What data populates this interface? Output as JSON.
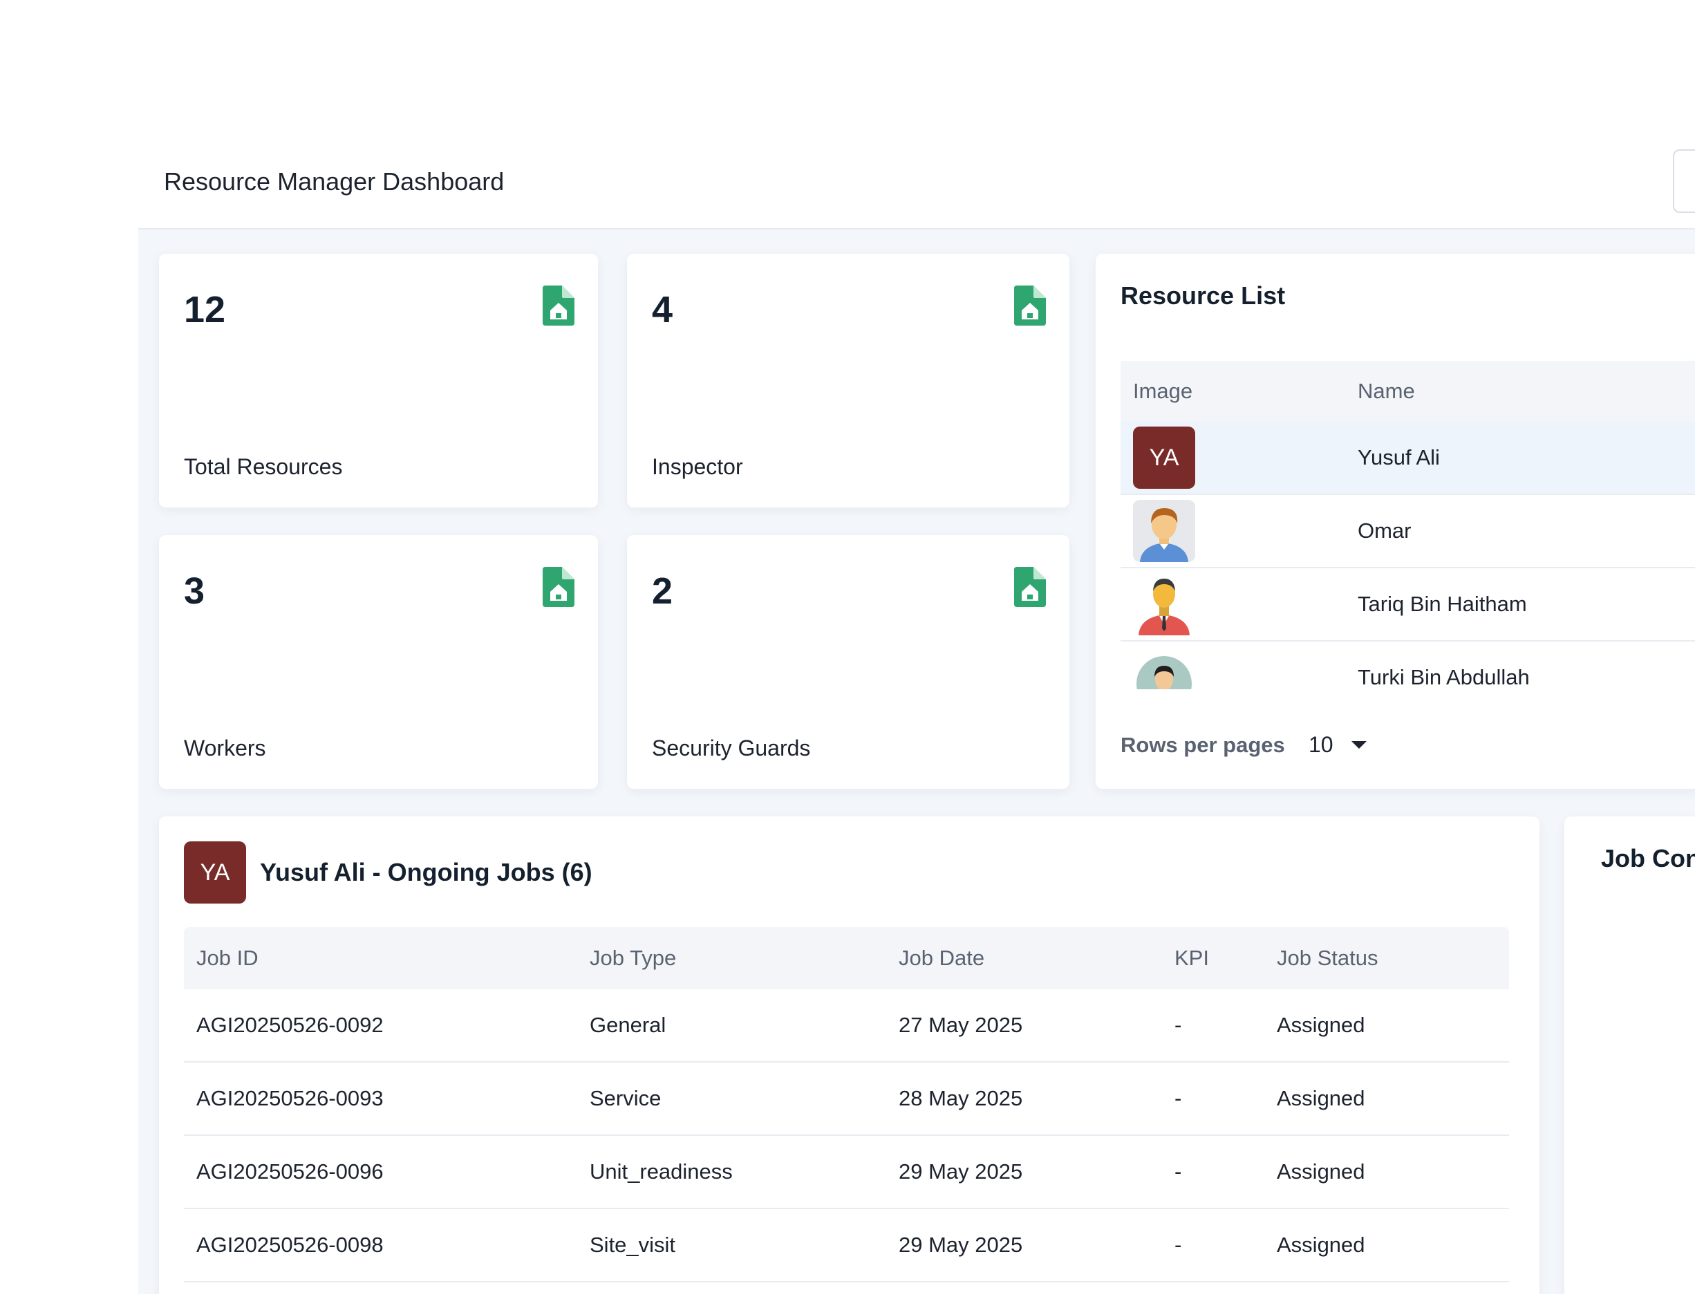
{
  "header": {
    "title": "Resource Manager Dashboard"
  },
  "stats": [
    {
      "value": "12",
      "label": "Total Resources",
      "icon": "document-icon"
    },
    {
      "value": "4",
      "label": "Inspector",
      "icon": "document-icon"
    },
    {
      "value": "3",
      "label": "Workers",
      "icon": "document-icon"
    },
    {
      "value": "2",
      "label": "Security Guards",
      "icon": "document-icon"
    }
  ],
  "resource_list": {
    "title": "Resource List",
    "columns": [
      "Image",
      "Name"
    ],
    "rows": [
      {
        "initials": "YA",
        "name": "Yusuf Ali"
      },
      {
        "name": "Omar"
      },
      {
        "name": "Tariq Bin Haitham"
      },
      {
        "name": "Turki Bin Abdullah"
      }
    ],
    "rows_per_page_label": "Rows per pages",
    "rows_per_page_value": "10"
  },
  "ongoing_jobs": {
    "initials": "YA",
    "title": "Yusuf Ali - Ongoing Jobs (6)",
    "columns": [
      "Job ID",
      "Job Type",
      "Job Date",
      "KPI",
      "Job Status"
    ],
    "rows": [
      [
        "AGI20250526-0092",
        "General",
        "27 May 2025",
        "-",
        "Assigned"
      ],
      [
        "AGI20250526-0093",
        "Service",
        "28 May 2025",
        "-",
        "Assigned"
      ],
      [
        "AGI20250526-0096",
        "Unit_readiness",
        "29 May 2025",
        "-",
        "Assigned"
      ],
      [
        "AGI20250526-0098",
        "Site_visit",
        "29 May 2025",
        "-",
        "Assigned"
      ]
    ]
  },
  "job_completion": {
    "title": "Job Con"
  },
  "colors": {
    "accent_green": "#2fa66f",
    "avatar_maroon": "#792b29"
  }
}
